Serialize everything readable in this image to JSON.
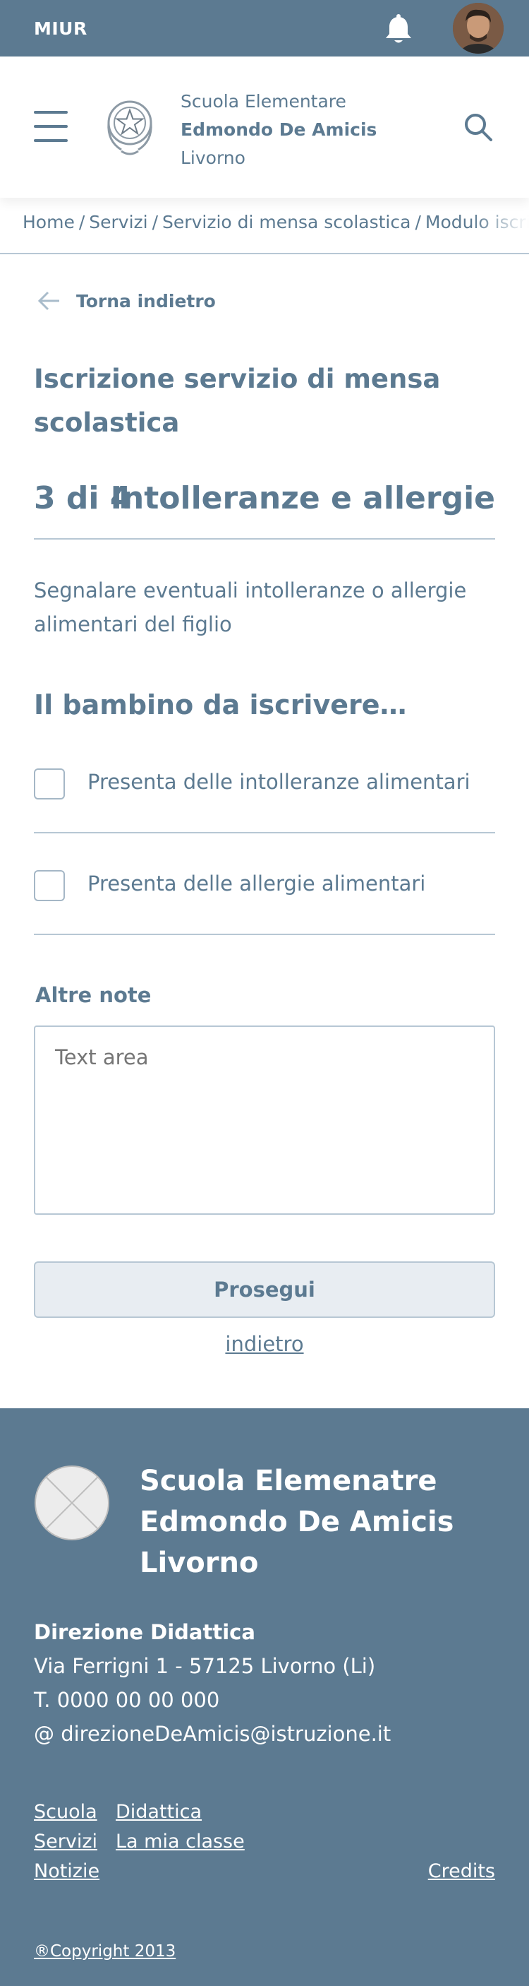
{
  "topbar": {
    "brand": "MIUR",
    "icons": [
      "bell-icon",
      "avatar"
    ]
  },
  "header": {
    "school_line1": "Scuola Elementare",
    "school_name": "Edmondo De Amicis",
    "school_city": "Livorno"
  },
  "breadcrumb": [
    "Home",
    "/",
    "Servizi",
    "/",
    "Servizio di mensa scolastica",
    "/",
    "Modulo iscrizione"
  ],
  "back_label": "Torna indietro",
  "page_title": "Iscrizione servizio di mensa scolastica",
  "step": {
    "number": "3 di 4",
    "name": "Intolleranze e allergie"
  },
  "description": "Segnalare eventuali intolleranze o allergie alimentari del figlio",
  "subtitle": "Il bambino da iscrivere…",
  "checkboxes": [
    {
      "label": "Presenta delle intolleranze alimentari",
      "checked": false
    },
    {
      "label": "Presenta delle allergie alimentari",
      "checked": false
    }
  ],
  "notes": {
    "label": "Altre note",
    "placeholder": "Text area",
    "value": ""
  },
  "continue_label": "Prosegui",
  "back_link": "indietro",
  "footer": {
    "school_name_1": "Scuola Elemenatre",
    "school_name_2": "Edmondo De Amicis",
    "school_name_3": "Livorno",
    "section_title": "Direzione Didattica",
    "address": "Via Ferrigni 1 - 57125 Livorno (Li)",
    "phone": "T. 0000 00 00 000",
    "email": "@ direzioneDeAmicis@istruzione.it",
    "links": [
      "Scuola",
      "Didattica",
      "Servizi",
      "La mia classe",
      "Notizie",
      "Credits"
    ],
    "copyright": "®Copyright 2013"
  },
  "colors": {
    "primary": "#5c7a91",
    "border": "#b7c7d4",
    "button_bg": "#e8edf2"
  }
}
